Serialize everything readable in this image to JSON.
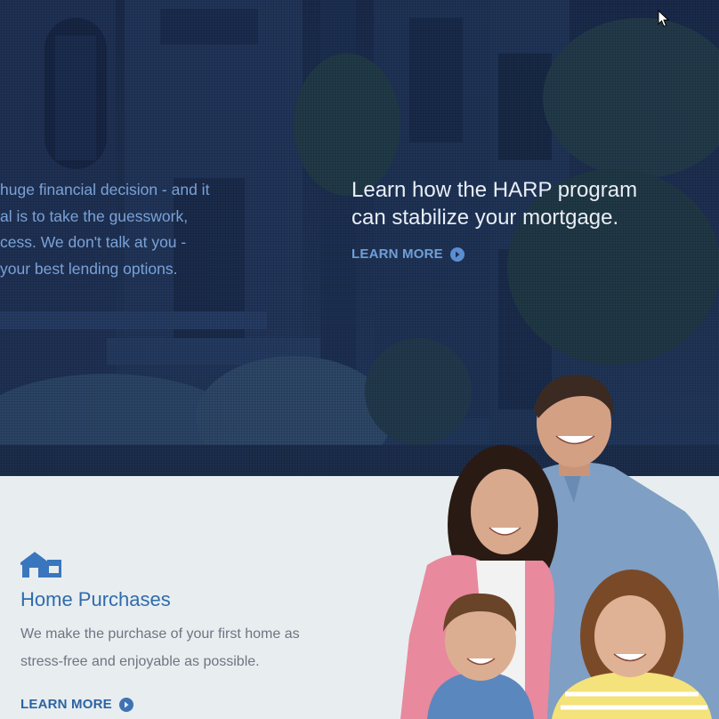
{
  "hero": {
    "left_text_lines": [
      "huge financial decision - and it",
      "al is to take the guesswork,",
      "cess. We don't talk at you -",
      "your best lending options."
    ],
    "headline_lines": [
      "Learn how the HARP program",
      "can stabilize your mortgage."
    ],
    "learn_more_label": "LEARN MORE"
  },
  "feature": {
    "icon": "house-icon",
    "title": "Home Purchases",
    "desc_lines": [
      "We make the purchase of your first home as",
      "stress-free and enjoyable as possible."
    ],
    "learn_more_label": "LEARN MORE"
  },
  "colors": {
    "hero_overlay": "#1d2e50",
    "hero_text": "#7aa2d6",
    "headline": "#e8eef6",
    "accent_blue": "#2f6cac",
    "section_bg": "#e8edf0"
  }
}
